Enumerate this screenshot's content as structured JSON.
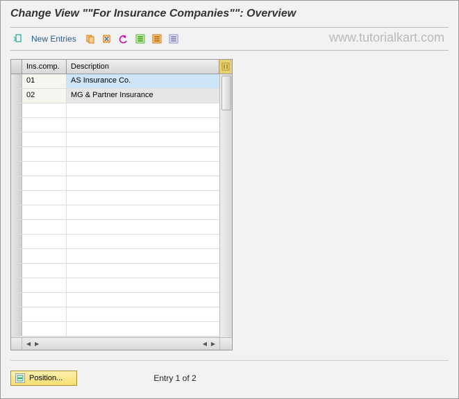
{
  "title": "Change View \"\"For Insurance Companies\"\": Overview",
  "watermark": "www.tutorialkart.com",
  "toolbar": {
    "new_entries_label": "New Entries"
  },
  "table": {
    "headers": {
      "code": "Ins.comp.",
      "desc": "Description"
    },
    "rows": [
      {
        "code": "01",
        "desc": "AS Insurance Co.",
        "selected": true
      },
      {
        "code": "02",
        "desc": "MG & Partner Insurance",
        "selected": false
      }
    ],
    "empty_row_count": 16
  },
  "footer": {
    "position_label": "Position...",
    "entry_label": "Entry 1 of 2"
  }
}
